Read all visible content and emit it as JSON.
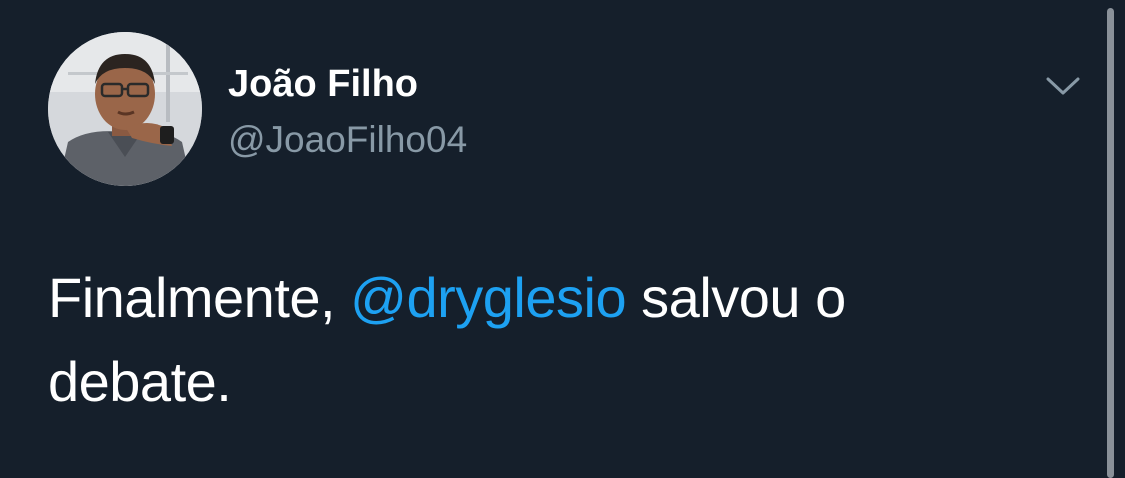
{
  "tweet": {
    "author": {
      "display_name": "João Filho",
      "handle": "@JoaoFilho04",
      "avatar_icon": "user-avatar-photo"
    },
    "text": {
      "before": "Finalmente, ",
      "mention": "@dryglesio",
      "after_line1": " salvou o",
      "line2": "debate."
    },
    "menu_icon": "chevron-down-icon"
  },
  "colors": {
    "background": "#151f2b",
    "text": "#ffffff",
    "secondary_text": "#8899a6",
    "link": "#1da1f2"
  }
}
